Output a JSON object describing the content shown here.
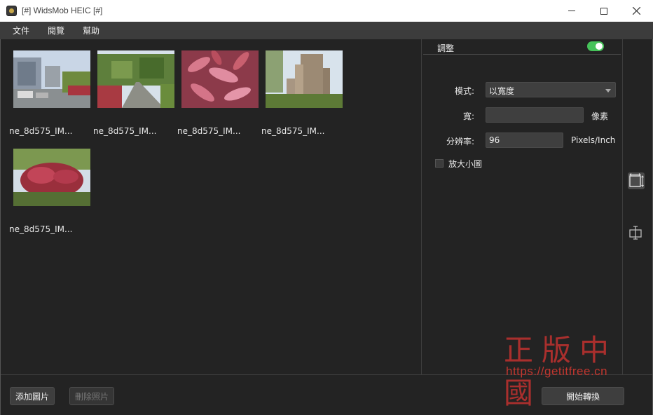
{
  "window": {
    "title": "[#] WidsMob HEIC [#]",
    "controls": {
      "minimize": "minimize-icon",
      "maximize": "maximize-icon",
      "close": "close-icon"
    }
  },
  "menu": [
    "文件",
    "閱覽",
    "幫助"
  ],
  "thumbnails": [
    {
      "label": "ne_8d575_IM...",
      "scene": "street-with-cars"
    },
    {
      "label": "ne_8d575_IM...",
      "scene": "tree-lined-road"
    },
    {
      "label": "ne_8d575_IM...",
      "scene": "red-leaves-closeup"
    },
    {
      "label": "ne_8d575_IM...",
      "scene": "tall-apartment-building"
    },
    {
      "label": "ne_8d575_IM...",
      "scene": "red-shrub-garden"
    }
  ],
  "panel": {
    "title": "調整",
    "toggle_on": true,
    "mode_label": "模式:",
    "mode_value": "以寬度",
    "width_label": "寬:",
    "width_value": "",
    "width_unit": "像素",
    "resolution_label": "分辨率:",
    "resolution_value": "96",
    "resolution_unit": "Pixels/Inch",
    "enlarge_label": "放大小圖",
    "enlarge_checked": false
  },
  "side_tools": [
    "resize-icon",
    "watermark-icon"
  ],
  "buttons": {
    "add": "添加圖片",
    "delete": "刪除照片",
    "start": "開始轉換"
  },
  "watermark": {
    "text": "正版中國",
    "url": "https://getitfree.cn"
  },
  "colors": {
    "background": "#232323",
    "menubar": "#3c3c3c",
    "toggle": "#46c35a",
    "watermark": "#b8312f"
  }
}
